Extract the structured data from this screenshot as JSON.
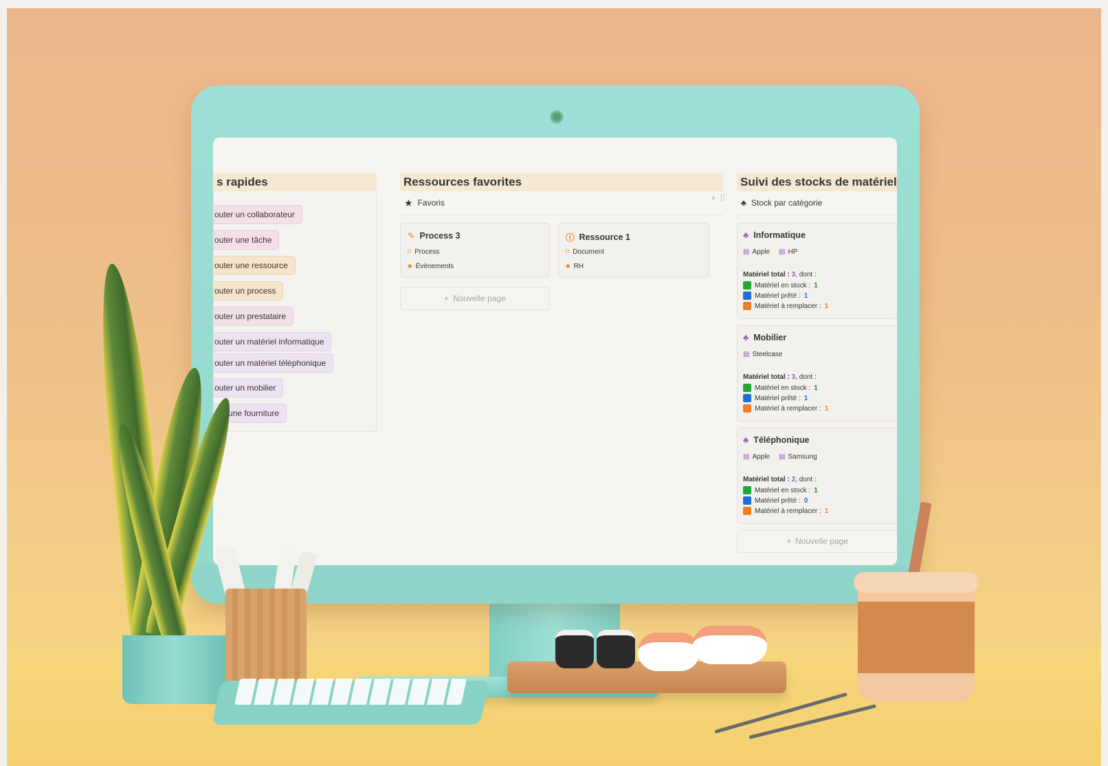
{
  "quick_actions": {
    "title": "s rapides",
    "buttons": [
      {
        "label": "outer un collaborateur"
      },
      {
        "label": "outer une tâche"
      },
      {
        "label": "outer une ressource"
      },
      {
        "label": "outer un process"
      },
      {
        "label": "outer un prestataire"
      },
      {
        "label": "outer un matériel informatique"
      },
      {
        "label": "outer un matériel téléphonique"
      },
      {
        "label": "outer un mobilier"
      },
      {
        "label": "out  une fourniture"
      }
    ]
  },
  "favorites": {
    "title": "Ressources favorites",
    "view_label": "Favoris",
    "cards": [
      {
        "title": "Process 3",
        "prop1": "Process",
        "prop2": "Évènements"
      },
      {
        "title": "Ressource 1",
        "prop1": "Document",
        "prop2": "RH"
      }
    ],
    "new_page": "Nouvelle page"
  },
  "stocks": {
    "title": "Suivi des stocks de matériel",
    "view_label": "Stock par catégorie",
    "new_page": "Nouvelle page",
    "categories": [
      {
        "name": "Informatique",
        "tags": [
          "Apple",
          "HP"
        ],
        "total_prefix": "Matériel total : ",
        "total": "3",
        "total_suffix": ", dont :",
        "stock_label": "Matériel en stock : ",
        "stock": "1",
        "lent_label": "Matériel prêté : ",
        "lent": "1",
        "replace_label": "Matériel à remplacer : ",
        "replace": "1"
      },
      {
        "name": "Mobilier",
        "tags": [
          "Steelcase"
        ],
        "total_prefix": "Matériel total : ",
        "total": "3",
        "total_suffix": ", dont :",
        "stock_label": "Matériel en stock : ",
        "stock": "1",
        "lent_label": "Matériel prêté : ",
        "lent": "1",
        "replace_label": "Matériel à remplacer : ",
        "replace": "1"
      },
      {
        "name": "Téléphonique",
        "tags": [
          "Apple",
          "Samsung"
        ],
        "total_prefix": "Matériel total : ",
        "total": "2",
        "total_suffix": ", dont :",
        "stock_label": "Matériel en stock : ",
        "stock": "1",
        "lent_label": "Matériel prêté : ",
        "lent": "0",
        "replace_label": "Matériel à remplacer : ",
        "replace": "1"
      }
    ]
  },
  "colors": {
    "header_bg": "#f7e8d3",
    "stock_green": "#1fa83a",
    "lent_blue": "#1e6ed8",
    "replace_orange": "#f07f1e",
    "category_purple": "#9b59b6"
  }
}
